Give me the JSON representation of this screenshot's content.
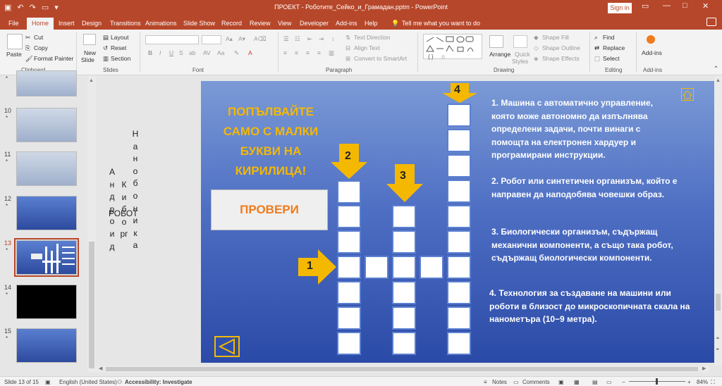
{
  "window": {
    "title": "ПРОЕКТ - Роботите_Сейко_и_Грамадан.pptm  -  PowerPoint",
    "sign_in": "Sign in"
  },
  "tabs": [
    "File",
    "Home",
    "Insert",
    "Design",
    "Transitions",
    "Animations",
    "Slide Show",
    "Record",
    "Review",
    "View",
    "Developer",
    "Add-ins",
    "Help"
  ],
  "active_tab": "Home",
  "tell_me": "Tell me what you want to do",
  "ribbon": {
    "clipboard": {
      "paste": "Paste",
      "cut": "Cut",
      "copy": "Copy",
      "format_painter": "Format Painter",
      "group": "Clipboard"
    },
    "slides": {
      "new_slide": "New",
      "new_slide2": "Slide",
      "layout": "Layout",
      "reset": "Reset",
      "section": "Section",
      "group": "Slides"
    },
    "font": {
      "group": "Font"
    },
    "paragraph": {
      "text_direction": "Text Direction",
      "align_text": "Align Text",
      "smartart": "Convert to SmartArt",
      "group": "Paragraph"
    },
    "drawing": {
      "arrange": "Arrange",
      "quick_styles": "Quick",
      "quick_styles2": "Styles",
      "shape_fill": "Shape Fill",
      "shape_outline": "Shape Outline",
      "shape_effects": "Shape Effects",
      "group": "Drawing"
    },
    "editing": {
      "find": "Find",
      "replace": "Replace",
      "select": "Select",
      "group": "Editing"
    },
    "addins": {
      "label": "Add-ins",
      "group": "Add-ins"
    }
  },
  "thumbnails": [
    {
      "num": "10",
      "star": "*",
      "kind": "scene"
    },
    {
      "num": "11",
      "star": "*",
      "kind": "scene"
    },
    {
      "num": "12",
      "star": "*",
      "kind": "blue"
    },
    {
      "num": "13",
      "star": "*",
      "kind": "blue",
      "active": true
    },
    {
      "num": "14",
      "star": "*",
      "kind": "black"
    },
    {
      "num": "15",
      "star": "*",
      "kind": "blue"
    }
  ],
  "offslide_words": {
    "w1": "Андроид",
    "w2": "Киборг",
    "w3": "Нанобоника",
    "robot": "РОБОТ"
  },
  "slide": {
    "title": "ПОПЪЛВАЙТЕ САМО С МАЛКИ БУКВИ НА КИРИЛИЦА!",
    "check_button": "ПРОВЕРИ",
    "numbers": [
      "1",
      "2",
      "3",
      "4"
    ],
    "clues": [
      "1. Машина с автоматично управление, която може автономно да изпълнява определени задачи, почти винаги с помощта на електронен хардуер и програмирани инструкции.",
      "2. Робот или синтетичен организъм, който е направен да наподобява човешки образ.",
      "3. Биологически организъм, съдържащ механични компоненти, а също така робот, съдържащ биологически компоненти.",
      "4. Технология за създаване на машини или роботи в близост до микроскопичната скала на нанометъра (10−9 метра)."
    ]
  },
  "status": {
    "slide": "Slide 13 of 15",
    "language": "English (United States)",
    "accessibility": "Accessibility: Investigate",
    "notes": "Notes",
    "comments": "Comments",
    "zoom": "84%"
  },
  "colors": {
    "accent": "#b7472a",
    "slide_title": "#f5b800",
    "check_text": "#f07b1c"
  }
}
